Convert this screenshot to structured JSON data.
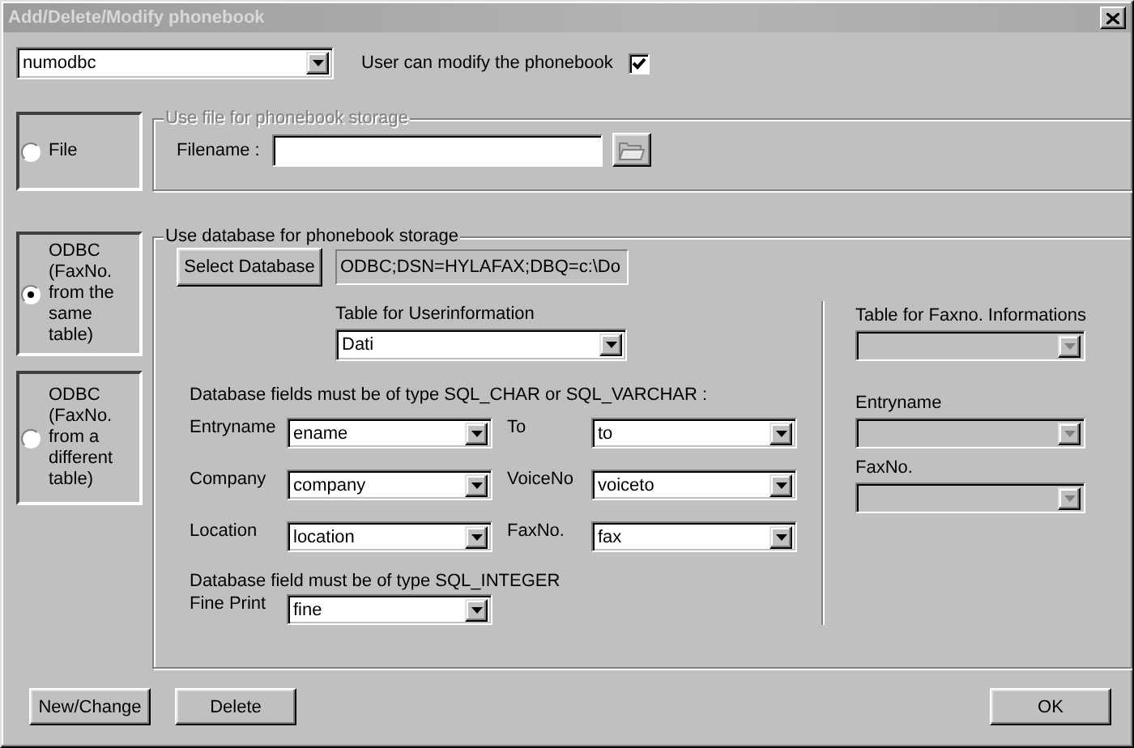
{
  "window": {
    "title": "Add/Delete/Modify phonebook"
  },
  "phonebook_select": {
    "value": "numodbc"
  },
  "modify_option": {
    "label": "User can modify the phonebook",
    "checked": true
  },
  "storage_options": [
    {
      "label": "File",
      "selected": false
    },
    {
      "label": "ODBC (FaxNo. from the same table)",
      "selected": true
    },
    {
      "label": "ODBC (FaxNo. from a different table)",
      "selected": false
    }
  ],
  "file_group": {
    "title": "Use file for phonebook storage",
    "disabled": true,
    "filename_label": "Filename :"
  },
  "database_group": {
    "title": "Use database for phonebook storage",
    "select_button": "Select Database",
    "connection": "ODBC;DSN=HYLAFAX;DBQ=c:\\Do",
    "user_table_label": "Table for Userinformation",
    "user_table": "Dati",
    "char_note": "Database fields must be of type SQL_CHAR or SQL_VARCHAR :",
    "fields": [
      {
        "label": "Entryname",
        "value": "ename"
      },
      {
        "label": "To",
        "value": "to"
      },
      {
        "label": "Company",
        "value": "company"
      },
      {
        "label": "VoiceNo",
        "value": "voiceto"
      },
      {
        "label": "Location",
        "value": "location"
      },
      {
        "label": "FaxNo.",
        "value": "fax"
      }
    ],
    "integer_note": "Database field must be of type SQL_INTEGER",
    "integer_fields": [
      {
        "label": "Fine Print",
        "value": "fine"
      }
    ]
  },
  "fax_table_group": {
    "disabled": true,
    "table_label": "Table for Faxno. Informations",
    "fields": [
      {
        "label": "Entryname"
      },
      {
        "label": "FaxNo."
      }
    ]
  },
  "buttons": [
    {
      "label": "New/Change"
    },
    {
      "label": "Delete"
    },
    {
      "label": "OK"
    }
  ]
}
